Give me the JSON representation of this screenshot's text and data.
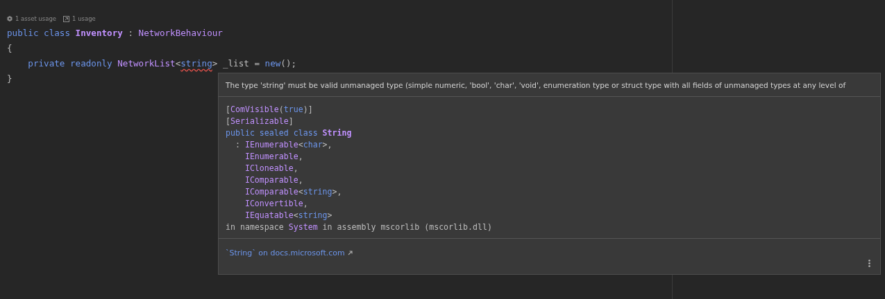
{
  "usage_hints": [
    {
      "kind": "asset",
      "text": "1 asset usage"
    },
    {
      "kind": "usage",
      "text": "1 usage"
    }
  ],
  "code_lines": [
    {
      "tokens": [
        {
          "text": "public class ",
          "kind": "keyword",
          "error": false
        },
        {
          "text": "Inventory",
          "kind": "class",
          "error": false
        },
        {
          "text": " : ",
          "kind": "plain",
          "error": false
        },
        {
          "text": "NetworkBehaviour",
          "kind": "type",
          "error": false
        }
      ]
    },
    {
      "tokens": [
        {
          "text": "{",
          "kind": "plain",
          "error": false
        }
      ]
    },
    {
      "tokens": [
        {
          "text": "    private readonly ",
          "kind": "keyword",
          "error": false
        },
        {
          "text": "NetworkList",
          "kind": "type",
          "error": false
        },
        {
          "text": "<",
          "kind": "plain",
          "error": false
        },
        {
          "text": "string",
          "kind": "keyword",
          "error": true
        },
        {
          "text": "> _list = ",
          "kind": "plain",
          "error": false
        },
        {
          "text": "new",
          "kind": "keyword",
          "error": false
        },
        {
          "text": "();",
          "kind": "plain",
          "error": false
        }
      ]
    },
    {
      "tokens": [
        {
          "text": "}",
          "kind": "plain",
          "error": false
        }
      ]
    }
  ],
  "popup": {
    "message": "The type 'string' must be valid unmanaged type (simple numeric, 'bool', 'char', 'void', enumeration type or struct type with all fields of unmanaged types at any level of",
    "doc_lines": [
      {
        "tokens": [
          {
            "text": "[",
            "kind": "plain"
          },
          {
            "text": "ComVisible",
            "kind": "type"
          },
          {
            "text": "(",
            "kind": "plain"
          },
          {
            "text": "true",
            "kind": "keyword"
          },
          {
            "text": ")]",
            "kind": "plain"
          }
        ]
      },
      {
        "tokens": [
          {
            "text": "[",
            "kind": "plain"
          },
          {
            "text": "Serializable",
            "kind": "type"
          },
          {
            "text": "]",
            "kind": "plain"
          }
        ]
      },
      {
        "tokens": [
          {
            "text": "public sealed class ",
            "kind": "keyword"
          },
          {
            "text": "String",
            "kind": "class"
          }
        ]
      },
      {
        "tokens": [
          {
            "text": "  : ",
            "kind": "plain"
          },
          {
            "text": "IEnumerable",
            "kind": "type"
          },
          {
            "text": "<",
            "kind": "plain"
          },
          {
            "text": "char",
            "kind": "keyword"
          },
          {
            "text": ">,",
            "kind": "plain"
          }
        ]
      },
      {
        "kind": "base",
        "tokens": [
          {
            "text": "IEnumerable",
            "kind": "type"
          },
          {
            "text": ",",
            "kind": "plain"
          }
        ]
      },
      {
        "kind": "base",
        "tokens": [
          {
            "text": "ICloneable",
            "kind": "type"
          },
          {
            "text": ",",
            "kind": "plain"
          }
        ]
      },
      {
        "kind": "base",
        "tokens": [
          {
            "text": "IComparable",
            "kind": "type"
          },
          {
            "text": ",",
            "kind": "plain"
          }
        ]
      },
      {
        "kind": "base",
        "tokens": [
          {
            "text": "IComparable",
            "kind": "type"
          },
          {
            "text": "<",
            "kind": "plain"
          },
          {
            "text": "string",
            "kind": "keyword"
          },
          {
            "text": ">,",
            "kind": "plain"
          }
        ]
      },
      {
        "kind": "base",
        "tokens": [
          {
            "text": "IConvertible",
            "kind": "type"
          },
          {
            "text": ",",
            "kind": "plain"
          }
        ]
      },
      {
        "kind": "base",
        "tokens": [
          {
            "text": "IEquatable",
            "kind": "type"
          },
          {
            "text": "<",
            "kind": "plain"
          },
          {
            "text": "string",
            "kind": "keyword"
          },
          {
            "text": ">",
            "kind": "plain"
          }
        ]
      },
      {
        "tokens": [
          {
            "text": "in namespace ",
            "kind": "plain"
          },
          {
            "text": "System",
            "kind": "type"
          },
          {
            "text": " in assembly mscorlib (mscorlib.dll)",
            "kind": "plain"
          }
        ]
      }
    ],
    "link": "`String` on docs.microsoft.com"
  }
}
